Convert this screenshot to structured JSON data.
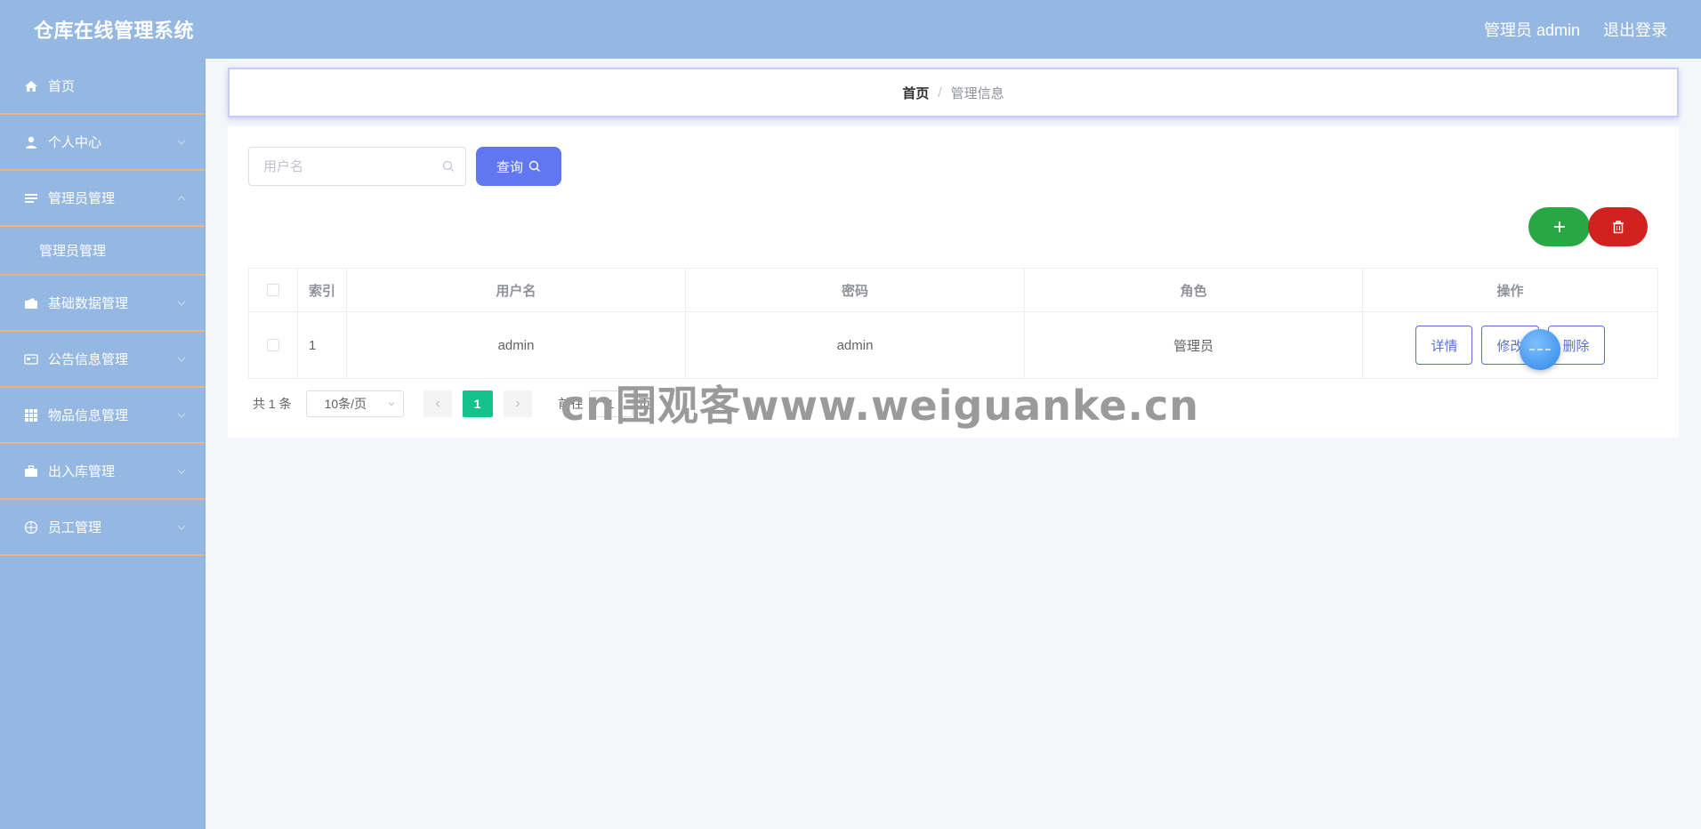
{
  "header": {
    "title": "仓库在线管理系统",
    "user_label": "管理员 admin",
    "logout_label": "退出登录"
  },
  "sidebar": {
    "items": [
      {
        "label": "首页",
        "icon": "home-icon"
      },
      {
        "label": "个人中心",
        "icon": "user-icon"
      },
      {
        "label": "管理员管理",
        "icon": "list-icon",
        "expanded": true,
        "sub": "管理员管理"
      },
      {
        "label": "基础数据管理",
        "icon": "wallet-icon"
      },
      {
        "label": "公告信息管理",
        "icon": "card-icon"
      },
      {
        "label": "物品信息管理",
        "icon": "grid-icon"
      },
      {
        "label": "出入库管理",
        "icon": "briefcase-icon"
      },
      {
        "label": "员工管理",
        "icon": "basketball-icon"
      }
    ]
  },
  "breadcrumb": {
    "home": "首页",
    "separator": "/",
    "current": "管理信息"
  },
  "search": {
    "placeholder": "用户名",
    "query_label": "查询"
  },
  "table": {
    "headers": {
      "index": "索引",
      "username": "用户名",
      "password": "密码",
      "role": "角色",
      "actions": "操作"
    },
    "rows": [
      {
        "index": "1",
        "username": "admin",
        "password": "admin",
        "role": "管理员"
      }
    ],
    "actions": {
      "detail": "详情",
      "edit": "修改",
      "delete": "删除"
    }
  },
  "pagination": {
    "total": "共 1 条",
    "page_size": "10条/页",
    "current_page": "1",
    "goto_label": "前往",
    "goto_value": "1",
    "goto_suffix": "页"
  },
  "watermark": "cn围观客www.weiguanke.cn",
  "colors": {
    "primary": "#95b8e3",
    "accent": "#6177f2",
    "add": "#28a745",
    "delete": "#d0231f",
    "page_active": "#13c38b"
  }
}
